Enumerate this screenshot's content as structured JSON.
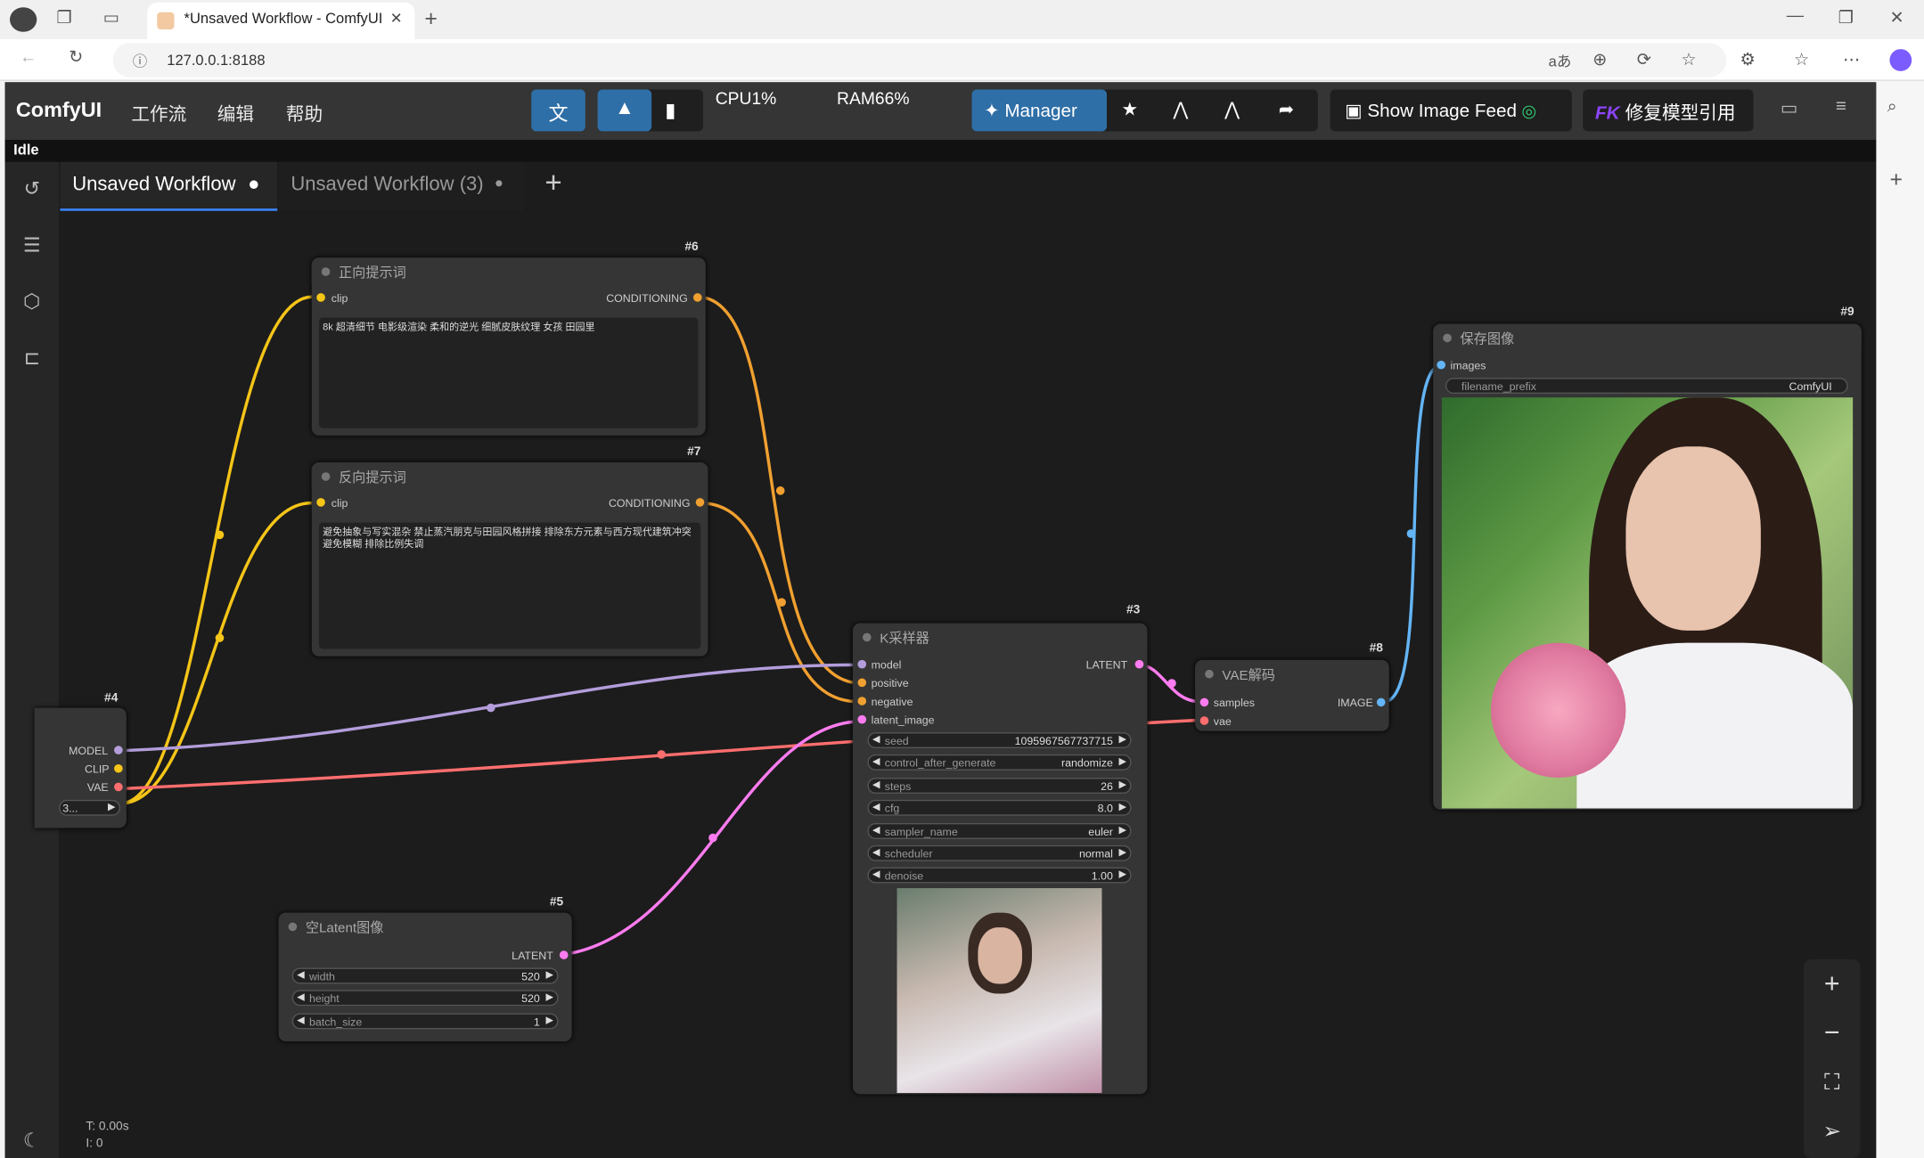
{
  "browser": {
    "tab_title": "*Unsaved Workflow - ComfyUI",
    "url": "127.0.0.1:8188"
  },
  "app": {
    "logo": "ComfyUI",
    "menu": [
      "工作流",
      "编辑",
      "帮助"
    ],
    "cpu": "CPU1%",
    "ram": "RAM66%",
    "manager_label": "Manager",
    "image_feed_label": "Show Image Feed",
    "fk_badge": "FK",
    "fix_model_label": "修复模型引用",
    "status": "Idle",
    "tabs": [
      {
        "label": "Unsaved Workflow",
        "active": true
      },
      {
        "label": "Unsaved Workflow (3)",
        "active": false
      }
    ],
    "stats": {
      "time": "T: 0.00s",
      "items": "I: 0"
    }
  },
  "nodes": {
    "positive": {
      "id": "#6",
      "title": "正向提示词",
      "input": "clip",
      "output": "CONDITIONING",
      "text": "8k 超清细节 电影级渲染 柔和的逆光 细腻皮肤纹理 女孩 田园里"
    },
    "negative": {
      "id": "#7",
      "title": "反向提示词",
      "input": "clip",
      "output": "CONDITIONING",
      "text": "避免抽象与写实混杂 禁止蒸汽朋克与田园风格拼接 排除东方元素与西方现代建筑冲突 避免模糊  排除比例失调"
    },
    "checkpoint": {
      "id": "#4",
      "outputs": [
        "MODEL",
        "CLIP",
        "VAE"
      ],
      "ckpt_value": "3..."
    },
    "latent": {
      "id": "#5",
      "title": "空Latent图像",
      "output": "LATENT",
      "widgets": [
        {
          "name": "width",
          "value": "520"
        },
        {
          "name": "height",
          "value": "520"
        },
        {
          "name": "batch_size",
          "value": "1"
        }
      ]
    },
    "ksampler": {
      "id": "#3",
      "title": "K采样器",
      "inputs": [
        "model",
        "positive",
        "negative",
        "latent_image"
      ],
      "output": "LATENT",
      "widgets": [
        {
          "name": "seed",
          "value": "1095967567737715"
        },
        {
          "name": "control_after_generate",
          "value": "randomize"
        },
        {
          "name": "steps",
          "value": "26"
        },
        {
          "name": "cfg",
          "value": "8.0"
        },
        {
          "name": "sampler_name",
          "value": "euler"
        },
        {
          "name": "scheduler",
          "value": "normal"
        },
        {
          "name": "denoise",
          "value": "1.00"
        }
      ]
    },
    "vae": {
      "id": "#8",
      "title": "VAE解码",
      "inputs": [
        "samples",
        "vae"
      ],
      "output": "IMAGE"
    },
    "save": {
      "id": "#9",
      "title": "保存图像",
      "input": "images",
      "prefix_label": "filename_prefix",
      "prefix_value": "ComfyUI"
    }
  },
  "colors": {
    "accent": "#2f6fa7",
    "clip": "#f5c518",
    "conditioning": "#f0a030",
    "model": "#b39ddb",
    "vae": "#ff6e6e",
    "latent": "#ff7cf0",
    "image": "#64b5f6"
  }
}
